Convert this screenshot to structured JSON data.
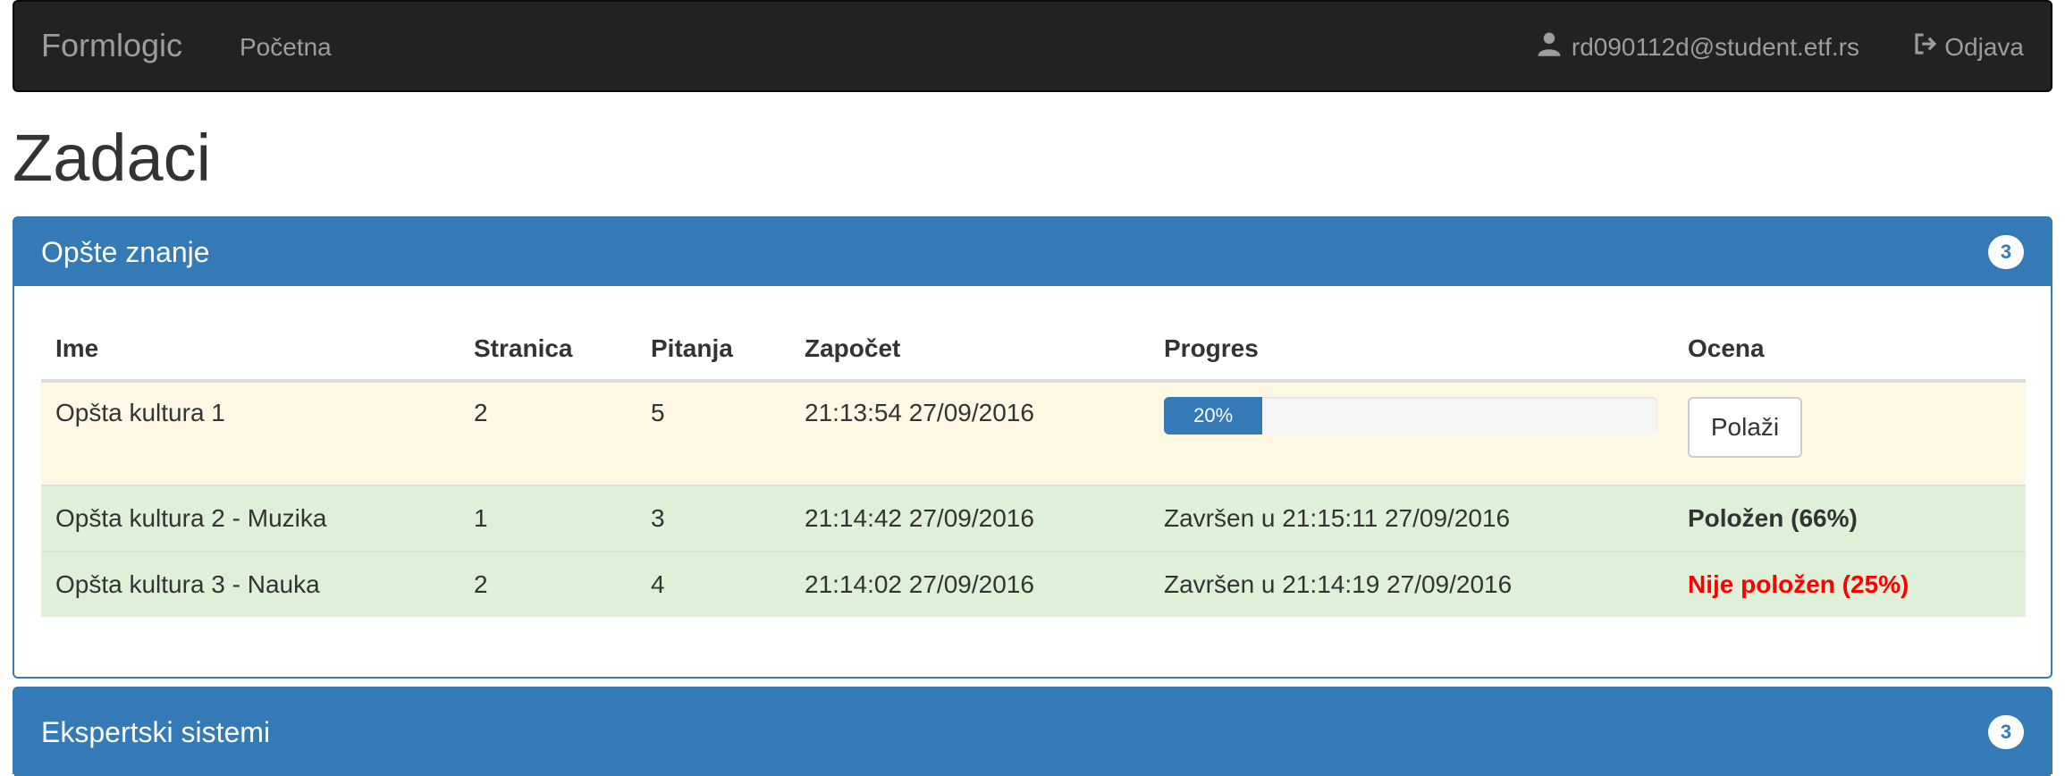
{
  "navbar": {
    "brand": "Formlogic",
    "home_label": "Početna",
    "user_email": "rd090112d@student.etf.rs",
    "logout_label": "Odjava"
  },
  "page": {
    "title": "Zadaci"
  },
  "panels": [
    {
      "title": "Opšte znanje",
      "badge": "3",
      "table": {
        "headers": [
          "Ime",
          "Stranica",
          "Pitanja",
          "Započet",
          "Progres",
          "Ocena"
        ],
        "rows": [
          {
            "name": "Opšta kultura 1",
            "pages": "2",
            "questions": "5",
            "started": "21:13:54 27/09/2016",
            "progress_text": "20%",
            "progress_percent": 20,
            "action_label": "Polaži"
          },
          {
            "name": "Opšta kultura 2 - Muzika",
            "pages": "1",
            "questions": "3",
            "started": "21:14:42 27/09/2016",
            "progress_text": "Završen u 21:15:11 27/09/2016",
            "grade": "Položen (66%)"
          },
          {
            "name": "Opšta kultura 3 - Nauka",
            "pages": "2",
            "questions": "4",
            "started": "21:14:02 27/09/2016",
            "progress_text": "Završen u 21:14:19 27/09/2016",
            "grade": "Nije položen (25%)"
          }
        ]
      }
    },
    {
      "title": "Ekspertski sistemi",
      "badge": "3"
    }
  ],
  "colors": {
    "primary": "#337ab7",
    "navbar_bg": "#222222",
    "warning_row": "#fcf8e3",
    "success_row": "#dff0d8",
    "failed_text": "#ff0000"
  },
  "icons": {
    "user": "user-icon",
    "logout": "logout-icon"
  }
}
